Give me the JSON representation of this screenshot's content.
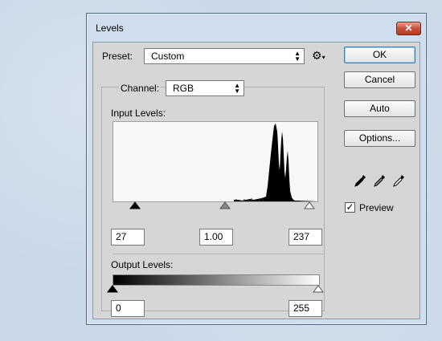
{
  "window": {
    "title": "Levels",
    "close_label": "✕"
  },
  "preset": {
    "label": "Preset:",
    "value": "Custom",
    "icon": "gear-icon"
  },
  "channel": {
    "label": "Channel:",
    "value": "RGB"
  },
  "input_levels": {
    "label": "Input Levels:",
    "black": "27",
    "gamma": "1.00",
    "white": "237"
  },
  "output_levels": {
    "label": "Output Levels:",
    "black": "0",
    "white": "255"
  },
  "buttons": {
    "ok": "OK",
    "cancel": "Cancel",
    "auto": "Auto",
    "options": "Options..."
  },
  "preview": {
    "label": "Preview",
    "checked": true
  },
  "eyedroppers": [
    "black-point-eyedropper-icon",
    "gray-point-eyedropper-icon",
    "white-point-eyedropper-icon"
  ]
}
